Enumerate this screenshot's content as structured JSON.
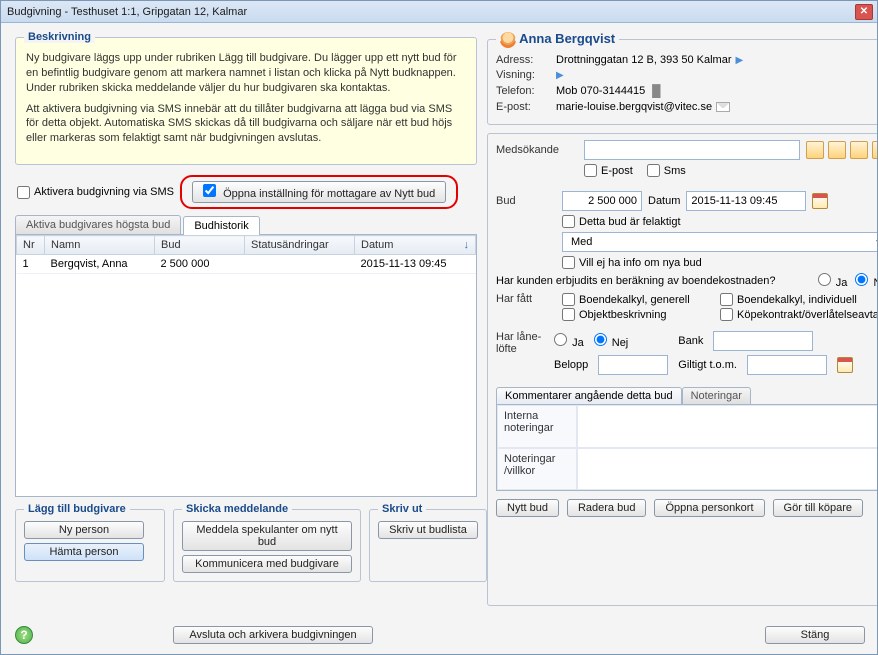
{
  "window": {
    "title": "Budgivning - Testhuset 1:1, Gripgatan 12, Kalmar"
  },
  "description": {
    "legend": "Beskrivning",
    "para1": "Ny budgivare läggs upp under rubriken Lägg till budgivare. Du lägger upp ett nytt bud för en befintlig budgivare genom att markera namnet i listan och klicka på Nytt budknappen. Under rubriken skicka meddelande väljer du hur budgivaren ska kontaktas.",
    "para2": "Att aktivera budgivning via SMS innebär att du tillåter budgivarna att lägga bud via SMS för detta objekt. Automatiska SMS skickas då till budgivarna och säljare när ett bud höjs eller markeras som felaktigt samt när budgivningen avslutas."
  },
  "sms_row": {
    "activate_sms": "Aktivera budgivning via SMS",
    "open_settings": "Öppna inställning för mottagare av Nytt bud"
  },
  "tabs": {
    "tab1": "Aktiva budgivares högsta bud",
    "tab2": "Budhistorik"
  },
  "table": {
    "headers": {
      "nr": "Nr",
      "namn": "Namn",
      "bud": "Bud",
      "status": "Statusändringar",
      "datum": "Datum"
    },
    "rows": [
      {
        "nr": "1",
        "namn": "Bergqvist, Anna",
        "bud": "2 500 000",
        "status": "",
        "datum": "2015-11-13 09:45"
      }
    ]
  },
  "add_bidder": {
    "legend": "Lägg till budgivare",
    "ny_person": "Ny person",
    "hamta_person": "Hämta person"
  },
  "send_msg": {
    "legend": "Skicka meddelande",
    "meddela": "Meddela spekulanter om nytt bud",
    "kommunicera": "Kommunicera med budgivare"
  },
  "skriv_ut": {
    "legend": "Skriv ut",
    "budlista": "Skriv ut budlista"
  },
  "person": {
    "name": "Anna Bergqvist",
    "adress_label": "Adress:",
    "adress": "Drottninggatan 12 B, 393 50  Kalmar",
    "visning_label": "Visning:",
    "telefon_label": "Telefon:",
    "telefon": "Mob 070-3144415",
    "epost_label": "E-post:",
    "epost": "marie-louise.bergqvist@vitec.se"
  },
  "medsokande": {
    "label": "Medsökande",
    "value": "",
    "epost_chk": "E-post",
    "sms_chk": "Sms"
  },
  "bud": {
    "label": "Bud",
    "value": "2 500 000",
    "datum_label": "Datum",
    "datum_value": "2015-11-13 09:45",
    "felaktigt": "Detta bud är felaktigt",
    "dropdown_value": "Med",
    "vill_ej": "Vill ej ha info om nya bud"
  },
  "berakning": {
    "question": "Har kunden erbjudits en beräkning av boendekostnaden?",
    "ja": "Ja",
    "nej": "Nej"
  },
  "har_fatt": {
    "label": "Har fått",
    "boendekalkyl_generell": "Boendekalkyl, generell",
    "boendekalkyl_individuell": "Boendekalkyl, individuell",
    "objektbeskrivning": "Objektbeskrivning",
    "kopekontrakt": "Köpekontrakt/överlåtelseavtal"
  },
  "lane": {
    "label": "Har låne-löfte",
    "ja": "Ja",
    "nej": "Nej",
    "bank_label": "Bank",
    "belopp_label": "Belopp",
    "giltigt_label": "Giltigt t.o.m."
  },
  "notes": {
    "tab1": "Kommentarer angående detta bud",
    "tab2": "Noteringar",
    "h1": "Interna noteringar",
    "h2": "Noteringar /villkor"
  },
  "buttons": {
    "nytt_bud": "Nytt bud",
    "radera_bud": "Radera bud",
    "oppna_personkort": "Öppna personkort",
    "gor_till_kopare": "Gör till köpare",
    "avsluta": "Avsluta och arkivera budgivningen",
    "stang": "Stäng"
  }
}
